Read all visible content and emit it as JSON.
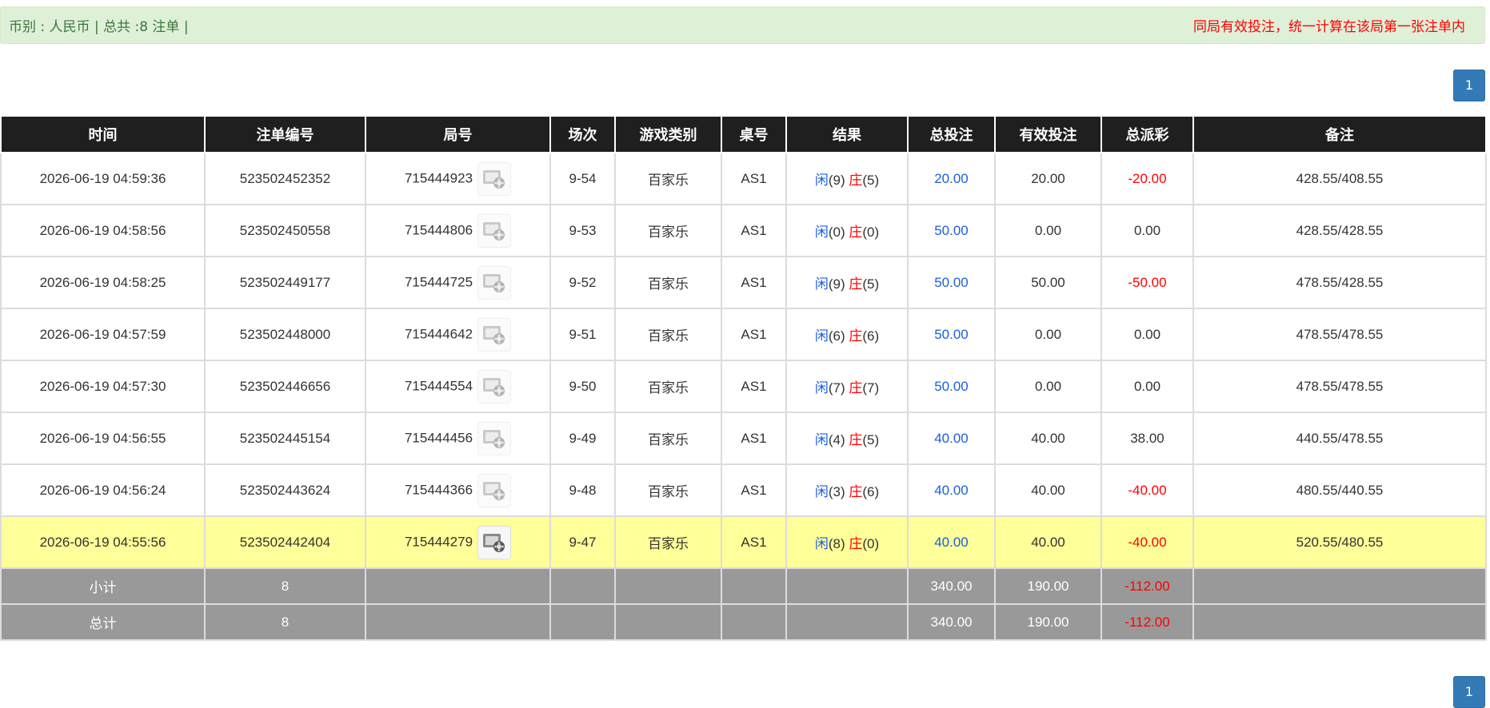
{
  "notice": {
    "summary": "币别 : 人民币 | 总共 :8 注单 |",
    "note": "同局有效投注，统一计算在该局第一张注单内"
  },
  "pagination": {
    "current_page": "1"
  },
  "table": {
    "headers": [
      "时间",
      "注单编号",
      "局号",
      "场次",
      "游戏类别",
      "桌号",
      "结果",
      "总投注",
      "有效投注",
      "总派彩",
      "备注"
    ],
    "rows": [
      {
        "time": "2026-06-19 04:59:36",
        "bet_id": "523502452352",
        "round_id": "715444923",
        "session": "9-54",
        "game": "百家乐",
        "table": "AS1",
        "player_label": "闲",
        "player_score": "(9)",
        "banker_label": "庄",
        "banker_score": "(5)",
        "total_bet": "20.00",
        "valid_bet": "20.00",
        "payout": "-20.00",
        "payout_negative": true,
        "remark": "428.55/408.55",
        "highlight": false
      },
      {
        "time": "2026-06-19 04:58:56",
        "bet_id": "523502450558",
        "round_id": "715444806",
        "session": "9-53",
        "game": "百家乐",
        "table": "AS1",
        "player_label": "闲",
        "player_score": "(0)",
        "banker_label": "庄",
        "banker_score": "(0)",
        "total_bet": "50.00",
        "valid_bet": "0.00",
        "payout": "0.00",
        "payout_negative": false,
        "remark": "428.55/428.55",
        "highlight": false
      },
      {
        "time": "2026-06-19 04:58:25",
        "bet_id": "523502449177",
        "round_id": "715444725",
        "session": "9-52",
        "game": "百家乐",
        "table": "AS1",
        "player_label": "闲",
        "player_score": "(9)",
        "banker_label": "庄",
        "banker_score": "(5)",
        "total_bet": "50.00",
        "valid_bet": "50.00",
        "payout": "-50.00",
        "payout_negative": true,
        "remark": "478.55/428.55",
        "highlight": false
      },
      {
        "time": "2026-06-19 04:57:59",
        "bet_id": "523502448000",
        "round_id": "715444642",
        "session": "9-51",
        "game": "百家乐",
        "table": "AS1",
        "player_label": "闲",
        "player_score": "(6)",
        "banker_label": "庄",
        "banker_score": "(6)",
        "total_bet": "50.00",
        "valid_bet": "0.00",
        "payout": "0.00",
        "payout_negative": false,
        "remark": "478.55/478.55",
        "highlight": false
      },
      {
        "time": "2026-06-19 04:57:30",
        "bet_id": "523502446656",
        "round_id": "715444554",
        "session": "9-50",
        "game": "百家乐",
        "table": "AS1",
        "player_label": "闲",
        "player_score": "(7)",
        "banker_label": "庄",
        "banker_score": "(7)",
        "total_bet": "50.00",
        "valid_bet": "0.00",
        "payout": "0.00",
        "payout_negative": false,
        "remark": "478.55/478.55",
        "highlight": false
      },
      {
        "time": "2026-06-19 04:56:55",
        "bet_id": "523502445154",
        "round_id": "715444456",
        "session": "9-49",
        "game": "百家乐",
        "table": "AS1",
        "player_label": "闲",
        "player_score": "(4)",
        "banker_label": "庄",
        "banker_score": "(5)",
        "total_bet": "40.00",
        "valid_bet": "40.00",
        "payout": "38.00",
        "payout_negative": false,
        "remark": "440.55/478.55",
        "highlight": false
      },
      {
        "time": "2026-06-19 04:56:24",
        "bet_id": "523502443624",
        "round_id": "715444366",
        "session": "9-48",
        "game": "百家乐",
        "table": "AS1",
        "player_label": "闲",
        "player_score": "(3)",
        "banker_label": "庄",
        "banker_score": "(6)",
        "total_bet": "40.00",
        "valid_bet": "40.00",
        "payout": "-40.00",
        "payout_negative": true,
        "remark": "480.55/440.55",
        "highlight": false
      },
      {
        "time": "2026-06-19 04:55:56",
        "bet_id": "523502442404",
        "round_id": "715444279",
        "session": "9-47",
        "game": "百家乐",
        "table": "AS1",
        "player_label": "闲",
        "player_score": "(8)",
        "banker_label": "庄",
        "banker_score": "(0)",
        "total_bet": "40.00",
        "valid_bet": "40.00",
        "payout": "-40.00",
        "payout_negative": true,
        "remark": "520.55/480.55",
        "highlight": true
      }
    ],
    "footer": [
      {
        "label": "小计",
        "count": "8",
        "total_bet": "340.00",
        "valid_bet": "190.00",
        "payout": "-112.00"
      },
      {
        "label": "总计",
        "count": "8",
        "total_bet": "340.00",
        "valid_bet": "190.00",
        "payout": "-112.00"
      }
    ]
  },
  "icons": {
    "replay": "video-replay-icon"
  },
  "colors": {
    "header_bg": "#1f1f1f",
    "highlight_row": "#ffff99",
    "footer_bg": "#999999",
    "bet_blue": "#1a5fe0",
    "negative_red": "#ff0000",
    "notice_bg": "#dff0d8"
  }
}
